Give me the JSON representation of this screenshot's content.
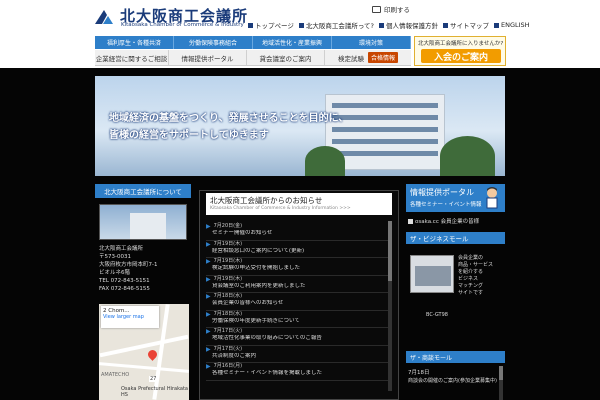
{
  "header": {
    "title": "北大阪商工会議所",
    "subtitle": "Kitaosaka Chamber of Commerce & Industry",
    "print_label": "印刷する",
    "util_nav": [
      "トップページ",
      "北大阪商工会議所って?",
      "個人情報保護方針",
      "サイトマップ",
      "ENGLISH"
    ]
  },
  "nav": {
    "blue_items": [
      "福利厚生・各種共済",
      "労働保険事務組合",
      "地域活性化・産業振興",
      "環境対策"
    ],
    "grey_items": [
      "企業経営に関するご相談",
      "情報提供ポータル",
      "貸会議室のご案内",
      "検定試験"
    ],
    "pass_badge": "合格情報",
    "join_small": "北大阪商工会議所に入りませんか?",
    "join_big": "入会のご案内"
  },
  "hero": {
    "line1": "地域経済の基盤をつくり、発展させることを目的に、",
    "line2": "皆様の経営をサポートしてゆきます"
  },
  "left": {
    "heading": "北大阪商工会議所について",
    "info_lines": [
      "北大阪商工会議所",
      "〒573-0031",
      "大阪府枚方市岡本町7-1",
      "ビオルネ6階",
      "TEL 072-843-5151",
      "FAX 072-846-5155"
    ],
    "map": {
      "place": "2 Chom...",
      "link": "View larger map",
      "area_label": "AMATECHO",
      "pin_num": "27",
      "school": "Osaka Prefectural Hirakata HS"
    }
  },
  "news": {
    "title": "北大阪商工会議所からのお知らせ",
    "subtitle": "Kitaosaka Chamber of Commerce & Industry Information >>>",
    "items": [
      {
        "date": "7月20日(金)",
        "text": "セミナー開催のお知らせ"
      },
      {
        "date": "7月19日(木)",
        "text": "経営相談窓口のご案内について(更新)"
      },
      {
        "date": "7月19日(木)",
        "text": "検定試験の申込受付を開始しました"
      },
      {
        "date": "7月19日(木)",
        "text": "貸会議室のご利用案内を更新しました"
      },
      {
        "date": "7月18日(水)",
        "text": "会員企業の皆様へのお知らせ"
      },
      {
        "date": "7月18日(水)",
        "text": "労働保険の年度更新手続きについて"
      },
      {
        "date": "7月17日(火)",
        "text": "地域活性化事業の取り組みについてのご報告"
      },
      {
        "date": "7月17日(火)",
        "text": "共済制度のご案内"
      },
      {
        "date": "7月16日(月)",
        "text": "各種セミナー・イベント情報を掲載しました"
      }
    ]
  },
  "right": {
    "portal_title": "情報提供ポータル",
    "portal_sub": "各種セミナー・イベント情報",
    "osaka_link": "osaka.cc 会員企業の皆様",
    "biz_heading": "ザ・ビジネスモール",
    "biz_text": [
      "会員企業の",
      "商品・サービス",
      "を紹介する",
      "ビジネス",
      "マッチング",
      "サイトです"
    ],
    "biz_caption": "BC-GT98",
    "seminar_heading": "ザ・商談モール",
    "seminar_date": "7月18日",
    "seminar_text": "商談会の開催のご案内(参加企業募集中)"
  }
}
